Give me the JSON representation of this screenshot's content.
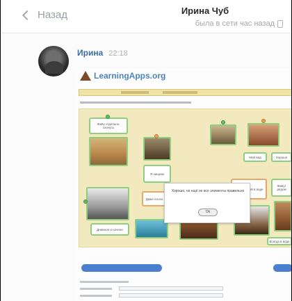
{
  "header": {
    "back_label": "Назад",
    "contact_name": "Ирина Чуб",
    "last_seen": "была в сети час назад"
  },
  "message": {
    "sender": "Ирина",
    "time": "22:18"
  },
  "attachment": {
    "site_name": "LearningApps.org",
    "dialog_text": "Хорошо, но ещё не все элементы правильно",
    "dialog_button": "Ok",
    "cards": {
      "c1": "Живу отдельно, охочусь",
      "c2": "Я хищник",
      "c3": "Мой вид",
      "c4": "Хорошо",
      "c5": "Даже плохо",
      "c6": "Едят",
      "c7": "Живут рядом",
      "c8": "Живут стаей в воде",
      "c9": "Дневное и ночное",
      "c10": "Всегда в воде"
    }
  },
  "colors": {
    "link_blue": "#3b6ea1",
    "card_border_green": "#8ecf7f",
    "board_yellow": "#f3e9bf"
  }
}
